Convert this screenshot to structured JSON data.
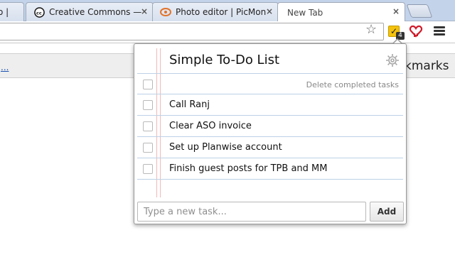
{
  "tabs": [
    {
      "title": "o |",
      "active": false
    },
    {
      "title": "Creative Commons — A",
      "active": false
    },
    {
      "title": "Photo editor | PicMonk",
      "active": false
    },
    {
      "title": "New Tab",
      "active": true
    }
  ],
  "tab_close_glyph": "×",
  "toolbar": {
    "star_icon": "star-icon",
    "todo_badge": "4"
  },
  "bookmarks": {
    "left_text": "...",
    "right_text": "kmarks"
  },
  "popup": {
    "title": "Simple To-Do List",
    "delete_completed_label": "Delete completed tasks",
    "tasks": [
      {
        "text": "Call Ranj",
        "done": false
      },
      {
        "text": "Clear ASO invoice",
        "done": false
      },
      {
        "text": "Set up Planwise account",
        "done": false
      },
      {
        "text": "Finish guest posts for TPB and MM",
        "done": false
      }
    ],
    "new_task_placeholder": "Type a new task...",
    "add_label": "Add"
  },
  "colors": {
    "accent_margin": "#f2b9b9",
    "rule": "#bcd0e6",
    "todo_icon": "#f4c20d",
    "heart_icon": "#d01b2a"
  }
}
